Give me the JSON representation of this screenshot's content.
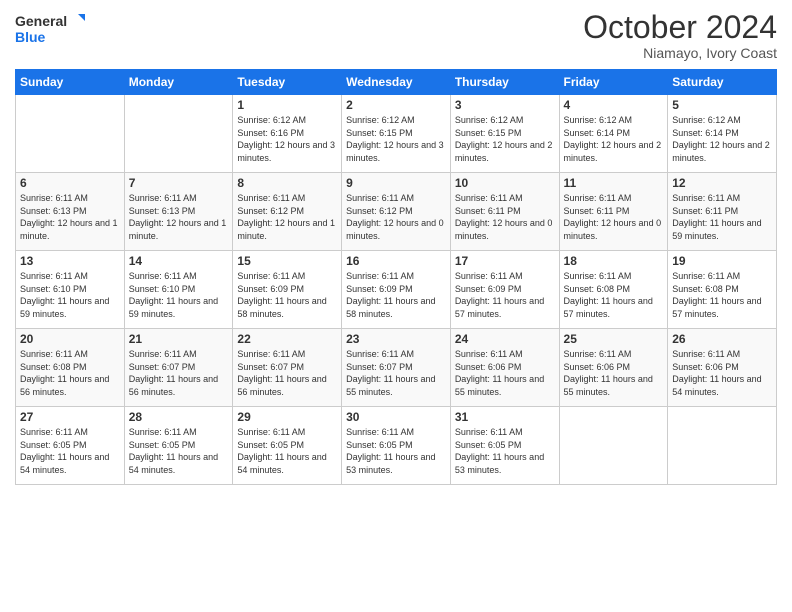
{
  "logo": {
    "line1": "General",
    "line2": "Blue"
  },
  "title": "October 2024",
  "location": "Niamayo, Ivory Coast",
  "days_of_week": [
    "Sunday",
    "Monday",
    "Tuesday",
    "Wednesday",
    "Thursday",
    "Friday",
    "Saturday"
  ],
  "weeks": [
    [
      null,
      null,
      {
        "day": "1",
        "sunrise": "6:12 AM",
        "sunset": "6:16 PM",
        "daylight": "12 hours and 3 minutes."
      },
      {
        "day": "2",
        "sunrise": "6:12 AM",
        "sunset": "6:15 PM",
        "daylight": "12 hours and 3 minutes."
      },
      {
        "day": "3",
        "sunrise": "6:12 AM",
        "sunset": "6:15 PM",
        "daylight": "12 hours and 2 minutes."
      },
      {
        "day": "4",
        "sunrise": "6:12 AM",
        "sunset": "6:14 PM",
        "daylight": "12 hours and 2 minutes."
      },
      {
        "day": "5",
        "sunrise": "6:12 AM",
        "sunset": "6:14 PM",
        "daylight": "12 hours and 2 minutes."
      }
    ],
    [
      {
        "day": "6",
        "sunrise": "6:11 AM",
        "sunset": "6:13 PM",
        "daylight": "12 hours and 1 minute."
      },
      {
        "day": "7",
        "sunrise": "6:11 AM",
        "sunset": "6:13 PM",
        "daylight": "12 hours and 1 minute."
      },
      {
        "day": "8",
        "sunrise": "6:11 AM",
        "sunset": "6:12 PM",
        "daylight": "12 hours and 1 minute."
      },
      {
        "day": "9",
        "sunrise": "6:11 AM",
        "sunset": "6:12 PM",
        "daylight": "12 hours and 0 minutes."
      },
      {
        "day": "10",
        "sunrise": "6:11 AM",
        "sunset": "6:11 PM",
        "daylight": "12 hours and 0 minutes."
      },
      {
        "day": "11",
        "sunrise": "6:11 AM",
        "sunset": "6:11 PM",
        "daylight": "12 hours and 0 minutes."
      },
      {
        "day": "12",
        "sunrise": "6:11 AM",
        "sunset": "6:11 PM",
        "daylight": "11 hours and 59 minutes."
      }
    ],
    [
      {
        "day": "13",
        "sunrise": "6:11 AM",
        "sunset": "6:10 PM",
        "daylight": "11 hours and 59 minutes."
      },
      {
        "day": "14",
        "sunrise": "6:11 AM",
        "sunset": "6:10 PM",
        "daylight": "11 hours and 59 minutes."
      },
      {
        "day": "15",
        "sunrise": "6:11 AM",
        "sunset": "6:09 PM",
        "daylight": "11 hours and 58 minutes."
      },
      {
        "day": "16",
        "sunrise": "6:11 AM",
        "sunset": "6:09 PM",
        "daylight": "11 hours and 58 minutes."
      },
      {
        "day": "17",
        "sunrise": "6:11 AM",
        "sunset": "6:09 PM",
        "daylight": "11 hours and 57 minutes."
      },
      {
        "day": "18",
        "sunrise": "6:11 AM",
        "sunset": "6:08 PM",
        "daylight": "11 hours and 57 minutes."
      },
      {
        "day": "19",
        "sunrise": "6:11 AM",
        "sunset": "6:08 PM",
        "daylight": "11 hours and 57 minutes."
      }
    ],
    [
      {
        "day": "20",
        "sunrise": "6:11 AM",
        "sunset": "6:08 PM",
        "daylight": "11 hours and 56 minutes."
      },
      {
        "day": "21",
        "sunrise": "6:11 AM",
        "sunset": "6:07 PM",
        "daylight": "11 hours and 56 minutes."
      },
      {
        "day": "22",
        "sunrise": "6:11 AM",
        "sunset": "6:07 PM",
        "daylight": "11 hours and 56 minutes."
      },
      {
        "day": "23",
        "sunrise": "6:11 AM",
        "sunset": "6:07 PM",
        "daylight": "11 hours and 55 minutes."
      },
      {
        "day": "24",
        "sunrise": "6:11 AM",
        "sunset": "6:06 PM",
        "daylight": "11 hours and 55 minutes."
      },
      {
        "day": "25",
        "sunrise": "6:11 AM",
        "sunset": "6:06 PM",
        "daylight": "11 hours and 55 minutes."
      },
      {
        "day": "26",
        "sunrise": "6:11 AM",
        "sunset": "6:06 PM",
        "daylight": "11 hours and 54 minutes."
      }
    ],
    [
      {
        "day": "27",
        "sunrise": "6:11 AM",
        "sunset": "6:05 PM",
        "daylight": "11 hours and 54 minutes."
      },
      {
        "day": "28",
        "sunrise": "6:11 AM",
        "sunset": "6:05 PM",
        "daylight": "11 hours and 54 minutes."
      },
      {
        "day": "29",
        "sunrise": "6:11 AM",
        "sunset": "6:05 PM",
        "daylight": "11 hours and 54 minutes."
      },
      {
        "day": "30",
        "sunrise": "6:11 AM",
        "sunset": "6:05 PM",
        "daylight": "11 hours and 53 minutes."
      },
      {
        "day": "31",
        "sunrise": "6:11 AM",
        "sunset": "6:05 PM",
        "daylight": "11 hours and 53 minutes."
      },
      null,
      null
    ]
  ]
}
